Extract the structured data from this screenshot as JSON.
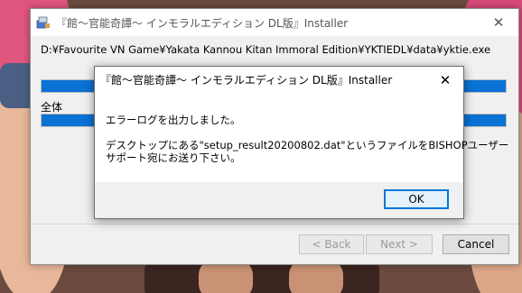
{
  "installer": {
    "title": "『館～官能奇譚～ インモラルエディション DL版』Installer",
    "close_glyph": "✕",
    "path": "D:¥Favourite VN Game¥Yakata Kannou Kitan Immoral Edition¥YKTIEDL¥data¥yktie.exe",
    "file_progress": 1.0,
    "all_label": "全体",
    "total_progress": 1.0,
    "buttons": {
      "back": "< Back",
      "next": "Next >",
      "cancel": "Cancel"
    }
  },
  "dialog": {
    "title": "『館～官能奇譚～ インモラルエディション DL版』Installer",
    "close_glyph": "✕",
    "message_line1": "エラーログを出力しました。",
    "message_line2": "デスクトップにある\"setup_result20200802.dat\"というファイルをBISHOPユーザー",
    "message_line3": "サポート宛にお送り下さい。",
    "ok_label": "OK"
  },
  "colors": {
    "progress_fill": "#0a72d4",
    "focus_border": "#0078d7"
  }
}
